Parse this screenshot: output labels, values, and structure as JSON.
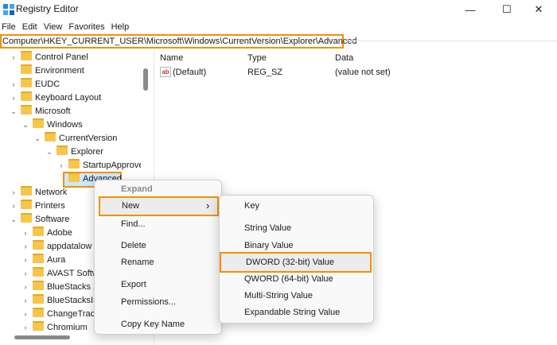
{
  "window": {
    "title": "Registry Editor",
    "min": "—",
    "max": "☐",
    "close": "✕"
  },
  "menubar": [
    "File",
    "Edit",
    "View",
    "Favorites",
    "Help"
  ],
  "address": "Computer\\HKEY_CURRENT_USER\\Microsoft\\Windows\\CurrentVersion\\Explorer\\Advanced",
  "tree": {
    "items": [
      {
        "label": "Control Panel",
        "chev": "›",
        "level": 1
      },
      {
        "label": "Environment",
        "chev": "",
        "level": 1
      },
      {
        "label": "EUDC",
        "chev": "›",
        "level": 1
      },
      {
        "label": "Keyboard Layout",
        "chev": "›",
        "level": 1
      },
      {
        "label": "Microsoft",
        "chev": "⌄",
        "level": 1
      },
      {
        "label": "Windows",
        "chev": "⌄",
        "level": 2
      },
      {
        "label": "CurrentVersion",
        "chev": "⌄",
        "level": 3
      },
      {
        "label": "Explorer",
        "chev": "⌄",
        "level": 4
      },
      {
        "label": "StartupApprove",
        "chev": "›",
        "level": 5
      },
      {
        "label": "Advanced",
        "chev": "",
        "level": 5
      },
      {
        "label": "Network",
        "chev": "›",
        "level": 1
      },
      {
        "label": "Printers",
        "chev": "›",
        "level": 1
      },
      {
        "label": "Software",
        "chev": "⌄",
        "level": 1
      },
      {
        "label": "Adobe",
        "chev": "›",
        "level": 2
      },
      {
        "label": "appdatalow",
        "chev": "›",
        "level": 2
      },
      {
        "label": "Aura",
        "chev": "›",
        "level": 2
      },
      {
        "label": "AVAST Softw",
        "chev": "›",
        "level": 2
      },
      {
        "label": "BlueStacks X",
        "chev": "›",
        "level": 2
      },
      {
        "label": "BlueStacksIns",
        "chev": "›",
        "level": 2
      },
      {
        "label": "ChangeTracke",
        "chev": "›",
        "level": 2
      },
      {
        "label": "Chromium",
        "chev": "›",
        "level": 2
      }
    ]
  },
  "values": {
    "headers": {
      "name": "Name",
      "type": "Type",
      "data": "Data"
    },
    "rows": [
      {
        "icon": "ab",
        "name": "(Default)",
        "type": "REG_SZ",
        "data": "(value not set)"
      }
    ]
  },
  "context_menu": {
    "expand": "Expand",
    "new": "New",
    "new_arrow": "›",
    "find": "Find...",
    "delete": "Delete",
    "rename": "Rename",
    "export": "Export",
    "permissions": "Permissions...",
    "copy_key_name": "Copy Key Name"
  },
  "submenu": {
    "key": "Key",
    "string_value": "String Value",
    "binary_value": "Binary Value",
    "dword_value": "DWORD (32-bit) Value",
    "qword_value": "QWORD (64-bit) Value",
    "multi_string_value": "Multi-String Value",
    "expandable_string_value": "Expandable String Value"
  },
  "colors": {
    "highlight": "#f29100",
    "folder": "#f6c64a",
    "selection": "#cde8ff"
  }
}
